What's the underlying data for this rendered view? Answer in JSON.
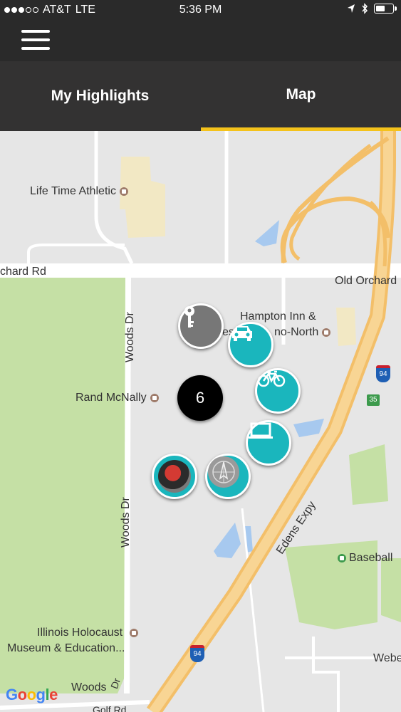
{
  "status_bar": {
    "carrier": "AT&T",
    "network": "LTE",
    "time": "5:36 PM"
  },
  "tabs": [
    {
      "label": "My Highlights",
      "active": false
    },
    {
      "label": "Map",
      "active": true
    }
  ],
  "accent_color": "#f4c21b",
  "marker_color": "#1ab6bd",
  "map": {
    "labels": {
      "lifetime": "Life Time Athletic",
      "orchard_rd_left": "chard Rd",
      "old_orchard": "Old Orchard",
      "hampton_line1": "Hampton Inn &",
      "hampton_line2": "es",
      "hampton_line2b": "no-North",
      "woods_dr_top": "Woods Dr",
      "woods_dr_mid": "Woods Dr",
      "woods_dr_bottom": "Woods",
      "woods_dr_bottom_suffix": "Dr",
      "rand_mcnally": "Rand McNally",
      "edens_expy": "Edens Expy",
      "baseball": "Baseball",
      "holocaust_line1": "Illinois Holocaust",
      "holocaust_line2": "Museum & Education...",
      "weber": "Webe",
      "golf_rd": "Golf Rd",
      "interstate_shield_1": "94",
      "interstate_shield_2": "94",
      "route_35": "35",
      "google": "Google"
    },
    "cluster_count": "6",
    "markers": [
      {
        "name": "key-icon"
      },
      {
        "name": "car-icon"
      },
      {
        "name": "bicycle-icon"
      },
      {
        "name": "laptop-icon"
      },
      {
        "name": "compass-icon"
      },
      {
        "name": "photo-thumbnail"
      }
    ]
  }
}
